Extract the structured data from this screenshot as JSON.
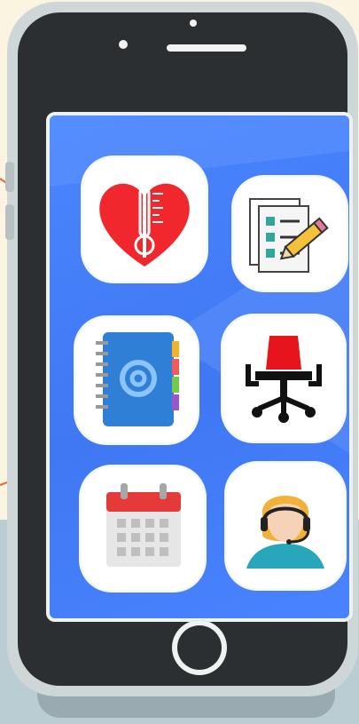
{
  "apps": [
    {
      "name": "health-app",
      "icon": "heart-thermometer-icon",
      "accent": "#f0282d"
    },
    {
      "name": "checklist-app",
      "icon": "checklist-pencil-icon",
      "accent": "#2ea59c"
    },
    {
      "name": "contacts-app",
      "icon": "address-book-icon",
      "accent": "#2f7fd6"
    },
    {
      "name": "office-app",
      "icon": "office-chair-icon",
      "accent": "#e8141c"
    },
    {
      "name": "calendar-app",
      "icon": "calendar-icon",
      "accent": "#e53a3a"
    },
    {
      "name": "support-app",
      "icon": "headset-agent-icon",
      "accent": "#0d9ab0"
    }
  ],
  "colors": {
    "screen": "#4a83ff",
    "phone_body": "#2b2f31",
    "frame": "#cfd6d8",
    "background": "#fbf4e1"
  }
}
